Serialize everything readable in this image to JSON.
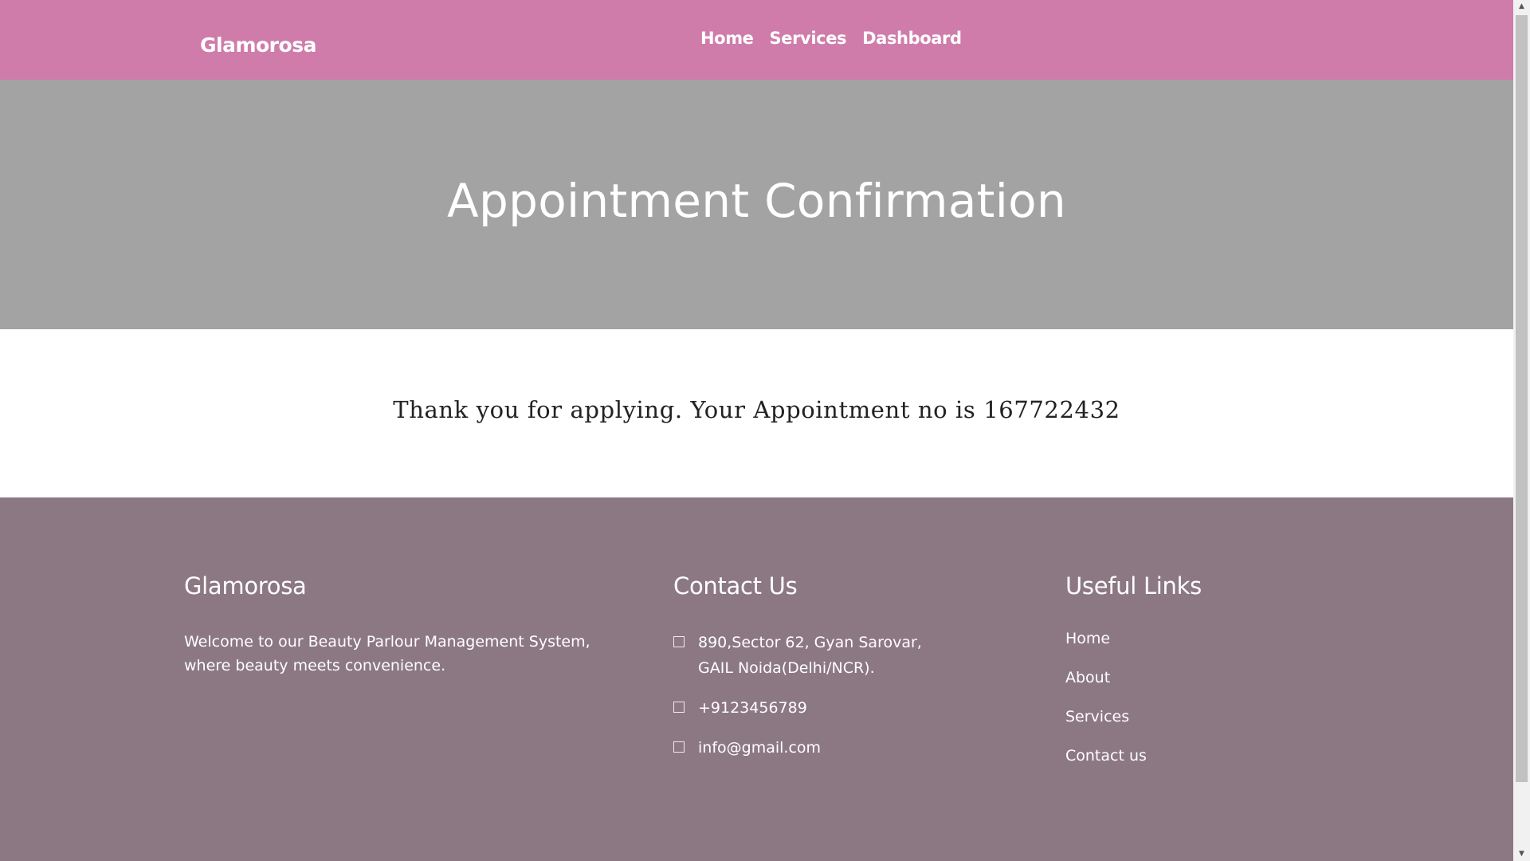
{
  "navbar": {
    "brand": "Glamorosa",
    "links": [
      {
        "label": "Home"
      },
      {
        "label": "Services"
      },
      {
        "label": "Dashboard"
      }
    ],
    "background": "#cf7cab"
  },
  "hero": {
    "title": "Appointment Confirmation",
    "background": "#a3a3a3"
  },
  "confirmation": {
    "message": "Thank you for applying. Your Appointment no is 167722432"
  },
  "footer": {
    "background": "#8c7882",
    "about": {
      "heading": "Glamorosa",
      "text": "Welcome to our Beauty Parlour Management System, where beauty meets convenience."
    },
    "contact": {
      "heading": "Contact Us",
      "items": [
        {
          "icon": "map-marker-icon",
          "text": "890,Sector 62, Gyan Sarovar, GAIL Noida(Delhi/NCR)."
        },
        {
          "icon": "phone-icon",
          "text": "+9123456789"
        },
        {
          "icon": "envelope-icon",
          "text": "info@gmail.com"
        }
      ]
    },
    "useful_links": {
      "heading": "Useful Links",
      "items": [
        {
          "label": "Home"
        },
        {
          "label": "About"
        },
        {
          "label": "Services"
        },
        {
          "label": "Contact us"
        }
      ]
    }
  }
}
